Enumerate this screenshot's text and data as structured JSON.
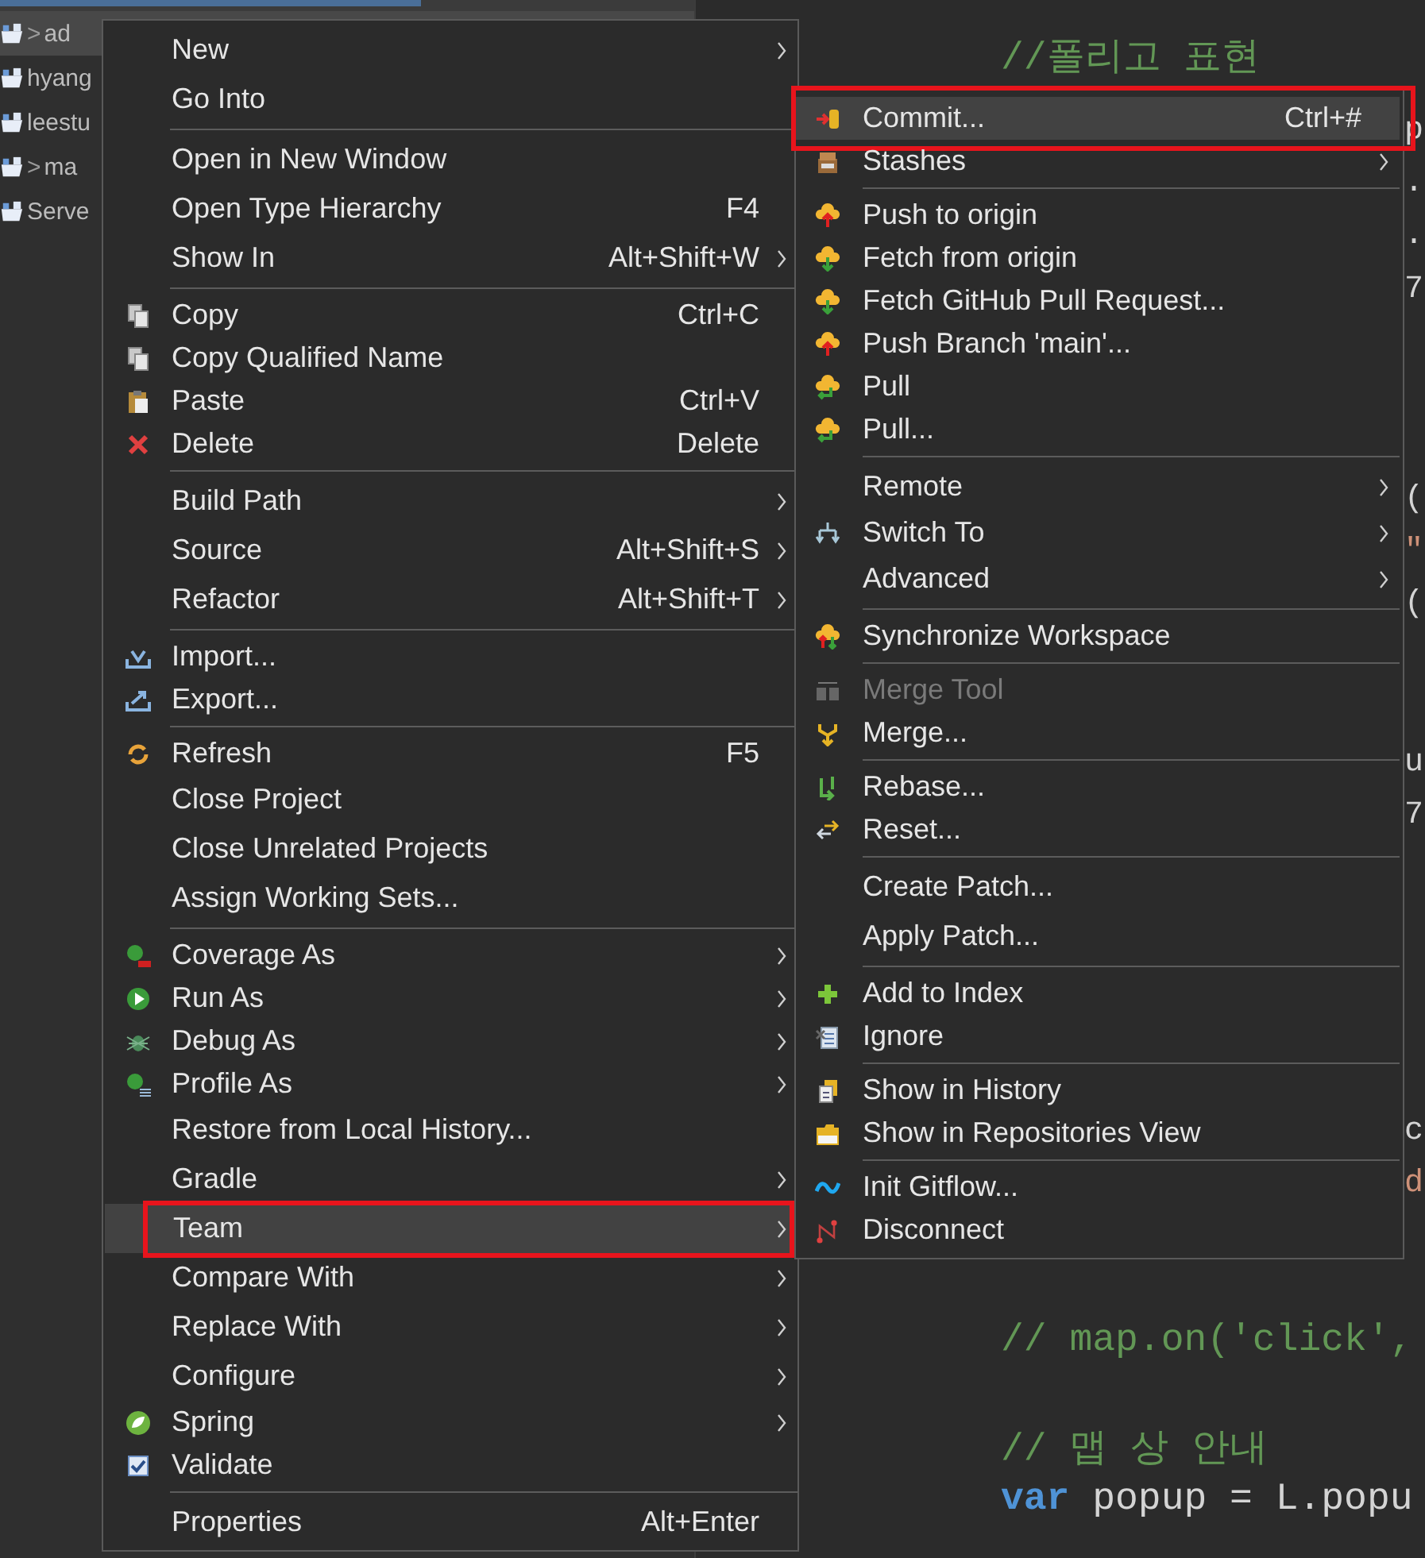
{
  "explorer": {
    "items": [
      {
        "expander": ">",
        "label": "ad",
        "selected": true
      },
      {
        "label": "hyang",
        "selected": false
      },
      {
        "label": "leestu",
        "selected": false
      },
      {
        "expander": ">",
        "label": "ma",
        "selected": false
      },
      {
        "label": "Serve",
        "selected": false
      }
    ]
  },
  "editor": {
    "lines": [
      {
        "segments": [
          {
            "text": "//폴리고 표현",
            "kind": "comment"
          }
        ]
      },
      {
        "segments": [
          {
            "text": "p",
            "kind": "plain"
          }
        ]
      },
      {
        "segments": [
          {
            "text": ".",
            "kind": "plain"
          }
        ]
      },
      {
        "segments": [
          {
            "text": ".",
            "kind": "plain"
          }
        ]
      },
      {
        "segments": [
          {
            "text": "7",
            "kind": "plain"
          }
        ]
      },
      {
        "segments": [
          {
            "text": "(",
            "kind": "plain"
          }
        ]
      },
      {
        "segments": [
          {
            "text": "\"",
            "kind": "string"
          }
        ]
      },
      {
        "segments": [
          {
            "text": "(",
            "kind": "plain"
          }
        ]
      },
      {
        "segments": [
          {
            "text": "u",
            "kind": "plain"
          }
        ]
      },
      {
        "segments": [
          {
            "text": "7",
            "kind": "plain"
          }
        ]
      },
      {
        "segments": [
          {
            "text": "c",
            "kind": "plain"
          }
        ]
      },
      {
        "segments": [
          {
            "text": "d",
            "kind": "string"
          }
        ]
      },
      {
        "segments": [
          {
            "text": "// map.on('click',",
            "kind": "comment"
          }
        ]
      },
      {
        "segments": [
          {
            "text": "// 맵 상 안내",
            "kind": "comment"
          }
        ]
      },
      {
        "segments": [
          {
            "text": "var",
            "kind": "keyword"
          },
          {
            "text": " popup = L.popu",
            "kind": "plain"
          }
        ]
      }
    ]
  },
  "context_menu": {
    "groups": [
      [
        {
          "label": "New",
          "submenu": true,
          "selected": false,
          "boxed": false
        },
        {
          "label": "Go Into",
          "submenu": false,
          "selected": false,
          "boxed": false
        }
      ],
      [
        {
          "label": "Open in New Window",
          "submenu": false,
          "selected": false,
          "boxed": false
        },
        {
          "label": "Open Type Hierarchy",
          "shortcut": "F4",
          "submenu": false,
          "selected": false,
          "boxed": false
        },
        {
          "label": "Show In",
          "shortcut": "Alt+Shift+W",
          "submenu": true,
          "selected": false,
          "boxed": false
        }
      ],
      [
        {
          "label": "Copy",
          "shortcut": "Ctrl+C",
          "submenu": false,
          "selected": false,
          "boxed": false
        },
        {
          "label": "Copy Qualified Name",
          "submenu": false,
          "selected": false,
          "boxed": false
        },
        {
          "label": "Paste",
          "shortcut": "Ctrl+V",
          "submenu": false,
          "selected": false,
          "boxed": false
        },
        {
          "label": "Delete",
          "shortcut": "Delete",
          "submenu": false,
          "selected": false,
          "boxed": false
        }
      ],
      [
        {
          "label": "Build Path",
          "submenu": true,
          "selected": false,
          "boxed": false
        },
        {
          "label": "Source",
          "shortcut": "Alt+Shift+S",
          "submenu": true,
          "selected": false,
          "boxed": false
        },
        {
          "label": "Refactor",
          "shortcut": "Alt+Shift+T",
          "submenu": true,
          "selected": false,
          "boxed": false
        }
      ],
      [
        {
          "label": "Import...",
          "submenu": false,
          "selected": false,
          "boxed": false
        },
        {
          "label": "Export...",
          "submenu": false,
          "selected": false,
          "boxed": false
        }
      ],
      [
        {
          "label": "Refresh",
          "shortcut": "F5",
          "submenu": false,
          "selected": false,
          "boxed": false
        },
        {
          "label": "Close Project",
          "submenu": false,
          "selected": false,
          "boxed": false
        },
        {
          "label": "Close Unrelated Projects",
          "submenu": false,
          "selected": false,
          "boxed": false
        },
        {
          "label": "Assign Working Sets...",
          "submenu": false,
          "selected": false,
          "boxed": false
        }
      ],
      [
        {
          "label": "Coverage As",
          "submenu": true,
          "selected": false,
          "boxed": false
        },
        {
          "label": "Run As",
          "submenu": true,
          "selected": false,
          "boxed": false
        },
        {
          "label": "Debug As",
          "submenu": true,
          "selected": false,
          "boxed": false
        },
        {
          "label": "Profile As",
          "submenu": true,
          "selected": false,
          "boxed": false
        },
        {
          "label": "Restore from Local History...",
          "submenu": false,
          "selected": false,
          "boxed": false
        },
        {
          "label": "Gradle",
          "submenu": true,
          "selected": false,
          "boxed": false
        },
        {
          "label": "Team",
          "submenu": true,
          "selected": true,
          "boxed": true
        },
        {
          "label": "Compare With",
          "submenu": true,
          "selected": false,
          "boxed": false
        },
        {
          "label": "Replace With",
          "submenu": true,
          "selected": false,
          "boxed": false
        },
        {
          "label": "Configure",
          "submenu": true,
          "selected": false,
          "boxed": false
        },
        {
          "label": "Spring",
          "submenu": true,
          "selected": false,
          "boxed": false
        },
        {
          "label": "Validate",
          "submenu": false,
          "selected": false,
          "boxed": false
        }
      ],
      [
        {
          "label": "Properties",
          "shortcut": "Alt+Enter",
          "submenu": false,
          "selected": false,
          "boxed": false
        }
      ]
    ]
  },
  "team_menu": {
    "groups": [
      [
        {
          "label": "Commit...",
          "shortcut": "Ctrl+#",
          "submenu": false,
          "selected": true,
          "boxed": true,
          "disabled": false
        },
        {
          "label": "Stashes",
          "submenu": true,
          "selected": false,
          "boxed": false,
          "disabled": false
        }
      ],
      [
        {
          "label": "Push to origin",
          "submenu": false,
          "selected": false,
          "boxed": false,
          "disabled": false
        },
        {
          "label": "Fetch from origin",
          "submenu": false,
          "selected": false,
          "boxed": false,
          "disabled": false
        },
        {
          "label": "Fetch GitHub Pull Request...",
          "submenu": false,
          "selected": false,
          "boxed": false,
          "disabled": false
        },
        {
          "label": "Push Branch 'main'...",
          "submenu": false,
          "selected": false,
          "boxed": false,
          "disabled": false
        },
        {
          "label": "Pull",
          "submenu": false,
          "selected": false,
          "boxed": false,
          "disabled": false
        },
        {
          "label": "Pull...",
          "submenu": false,
          "selected": false,
          "boxed": false,
          "disabled": false
        }
      ],
      [
        {
          "label": "Remote",
          "submenu": true,
          "selected": false,
          "boxed": false,
          "disabled": false
        },
        {
          "label": "Switch To",
          "submenu": true,
          "selected": false,
          "boxed": false,
          "disabled": false
        },
        {
          "label": "Advanced",
          "submenu": true,
          "selected": false,
          "boxed": false,
          "disabled": false
        }
      ],
      [
        {
          "label": "Synchronize Workspace",
          "submenu": false,
          "selected": false,
          "boxed": false,
          "disabled": false
        }
      ],
      [
        {
          "label": "Merge Tool",
          "submenu": false,
          "selected": false,
          "boxed": false,
          "disabled": true
        },
        {
          "label": "Merge...",
          "submenu": false,
          "selected": false,
          "boxed": false,
          "disabled": false
        }
      ],
      [
        {
          "label": "Rebase...",
          "submenu": false,
          "selected": false,
          "boxed": false,
          "disabled": false
        },
        {
          "label": "Reset...",
          "submenu": false,
          "selected": false,
          "boxed": false,
          "disabled": false
        }
      ],
      [
        {
          "label": "Create Patch...",
          "submenu": false,
          "selected": false,
          "boxed": false,
          "disabled": false
        },
        {
          "label": "Apply Patch...",
          "submenu": false,
          "selected": false,
          "boxed": false,
          "disabled": false
        }
      ],
      [
        {
          "label": "Add to Index",
          "submenu": false,
          "selected": false,
          "boxed": false,
          "disabled": false
        },
        {
          "label": "Ignore",
          "submenu": false,
          "selected": false,
          "boxed": false,
          "disabled": false
        }
      ],
      [
        {
          "label": "Show in History",
          "submenu": false,
          "selected": false,
          "boxed": false,
          "disabled": false
        },
        {
          "label": "Show in Repositories View",
          "submenu": false,
          "selected": false,
          "boxed": false,
          "disabled": false
        }
      ],
      [
        {
          "label": "Init Gitflow...",
          "submenu": false,
          "selected": false,
          "boxed": false,
          "disabled": false
        },
        {
          "label": "Disconnect",
          "submenu": false,
          "selected": false,
          "boxed": false,
          "disabled": false
        }
      ]
    ]
  }
}
